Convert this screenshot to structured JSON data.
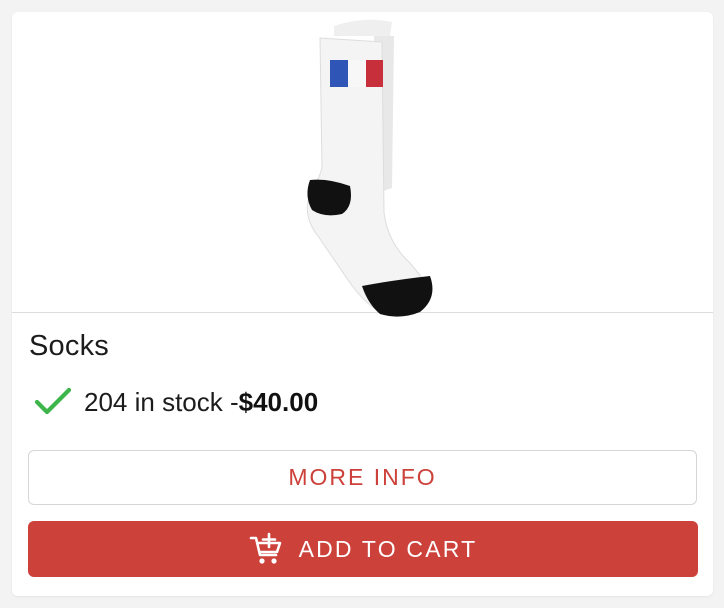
{
  "product": {
    "name": "Socks",
    "stock_text": "204 in stock - ",
    "price": "$40.00",
    "image_icon": "sock-with-french-flag"
  },
  "actions": {
    "more_info_label": "MORE INFO",
    "add_to_cart_label": "ADD TO CART",
    "add_to_cart_icon": "add-to-cart-icon"
  },
  "colors": {
    "accent": "#cc413a",
    "check": "#3db54a",
    "page_bg": "#f2f3f2",
    "card_bg": "#ffffff"
  }
}
